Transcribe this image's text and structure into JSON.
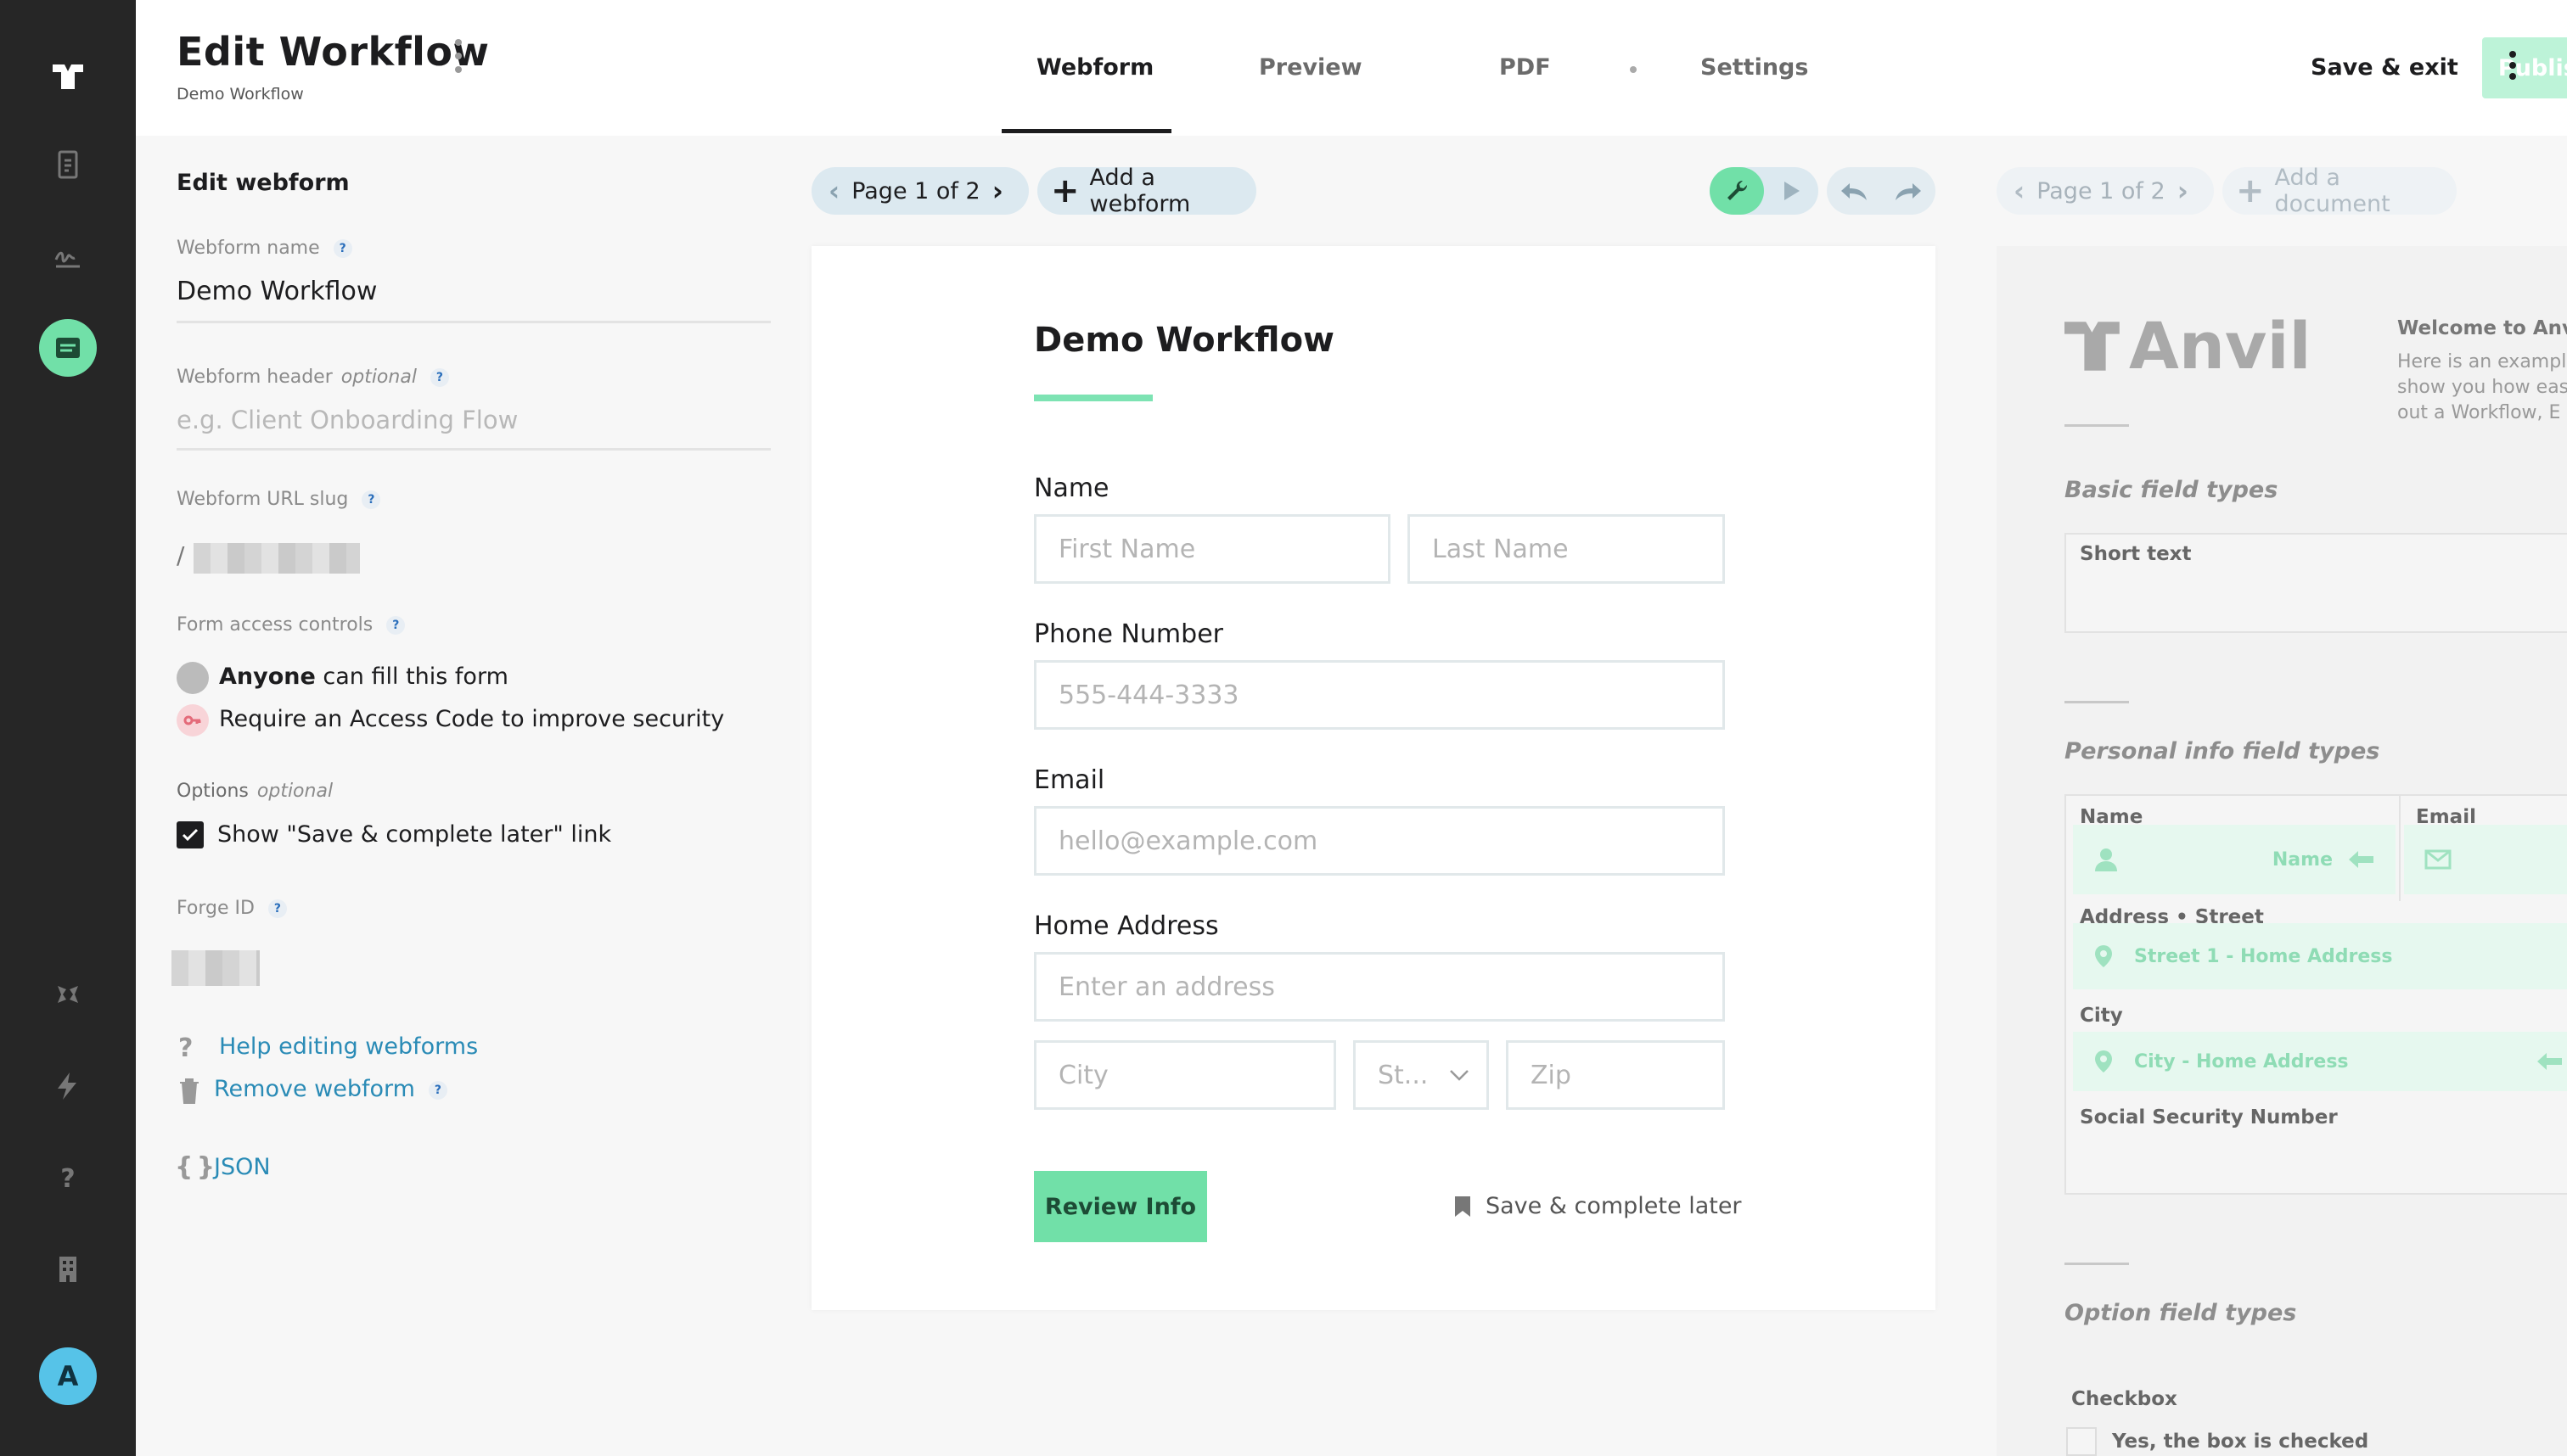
{
  "header": {
    "title": "Edit Workflow",
    "subtitle": "Demo Workflow",
    "tabs": [
      "Webform",
      "Preview",
      "PDF",
      "Settings"
    ],
    "save_exit": "Save & exit",
    "publish": "Publish"
  },
  "settings": {
    "section_title": "Edit webform",
    "webform_name_label": "Webform name",
    "webform_name_value": "Demo Workflow",
    "webform_header_label": "Webform header",
    "optional": "optional",
    "webform_header_placeholder": "e.g. Client Onboarding Flow",
    "url_slug_label": "Webform URL slug",
    "url_slug_prefix": "/",
    "access_label": "Form access controls",
    "access_anyone_bold": "Anyone",
    "access_anyone_rest": " can fill this form",
    "access_code": "Require an Access Code to improve security",
    "options_label": "Options",
    "save_later_option": "Show \"Save & complete later\" link",
    "forge_id_label": "Forge ID",
    "help_link": "Help editing webforms",
    "remove_link": "Remove webform",
    "json_link": "JSON",
    "json_braces": "{ }",
    "help_glyph": "?"
  },
  "toolbar": {
    "page_indicator": "Page 1 of 2",
    "add_webform": "Add a webform",
    "pdf_page_indicator": "Page 1 of 2",
    "add_document": "Add a document"
  },
  "form": {
    "title": "Demo Workflow",
    "name_label": "Name",
    "first_name_placeholder": "First Name",
    "last_name_placeholder": "Last Name",
    "phone_label": "Phone Number",
    "phone_placeholder": "555-444-3333",
    "email_label": "Email",
    "email_placeholder": "hello@example.com",
    "address_label": "Home Address",
    "address_placeholder": "Enter an address",
    "city_placeholder": "City",
    "state_placeholder": "St...",
    "zip_placeholder": "Zip",
    "review_button": "Review Info",
    "save_later_link": "Save & complete later"
  },
  "pdf": {
    "logo_text": "Anvil",
    "welcome_title": "Welcome to Anvil",
    "welcome_body_1": "Here is an exampl",
    "welcome_body_2": "show you how eas",
    "welcome_body_3": "out a Workflow, E",
    "basic_heading": "Basic field types",
    "short_text": "Short text",
    "personal_heading": "Personal info field types",
    "name_label": "Name",
    "name_field": "Name",
    "email_label": "Email",
    "address_label": "Address • Street",
    "street_field": "Street 1 - Home Address",
    "city_label": "City",
    "city_field": "City - Home Address",
    "ssn_label": "Social Security Number",
    "option_heading": "Option field types",
    "checkbox_label": "Checkbox",
    "checkbox_text": "Yes, the box is checked"
  },
  "user": {
    "avatar_initial": "A"
  },
  "colors": {
    "accent_green": "#71e0a8",
    "rail_bg": "#262626",
    "link_blue": "#2a8bb6"
  }
}
